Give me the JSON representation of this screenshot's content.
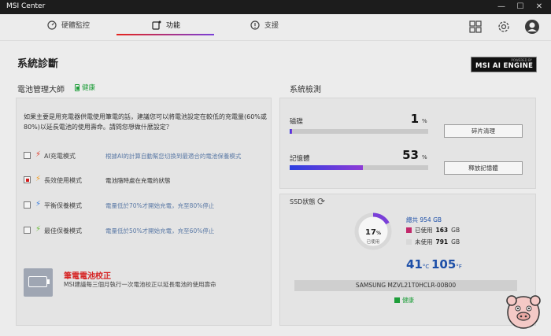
{
  "window": {
    "title": "MSI Center",
    "minimize": "—",
    "maximize": "☐",
    "close": "✕"
  },
  "nav": {
    "tabs": [
      {
        "label": "硬體監控"
      },
      {
        "label": "功能"
      },
      {
        "label": "支援"
      }
    ],
    "active_tab": "功能"
  },
  "page": {
    "title": "系統診斷",
    "badge_small": "POWERED BY",
    "badge": "MSI AI ENGINE"
  },
  "battery": {
    "heading": "電池管理大師",
    "health": "健康",
    "description": "如果主要是用充電器供電使用筆電的話，建議您可以將電池設定在較低的充電量(60%或80%)以延長電池的使用壽命。請問您想做什麼設定？",
    "modes": [
      {
        "name": "AI充電模式",
        "desc": "根據AI的計算自動幫您切換到最適合的電池保養模式",
        "bolt_color": "#e03a2a",
        "checked": false
      },
      {
        "name": "長效使用模式",
        "desc": "電池隨時處在充電的狀態",
        "bolt_color": "#f29a1f",
        "checked": true
      },
      {
        "name": "平衡保養模式",
        "desc": "電量低於70%才開始充電，充至80%停止",
        "bolt_color": "#3a7fe0",
        "checked": false
      },
      {
        "name": "最佳保養模式",
        "desc": "電量低於50%才開始充電，充至60%停止",
        "bolt_color": "#66bb33",
        "checked": false
      }
    ],
    "calibration": {
      "title": "筆電電池校正",
      "desc": "MSI建議每三個月執行一次電池校正以延長電池的使用壽命"
    }
  },
  "system_check": {
    "heading": "系統檢測",
    "disk": {
      "label": "磁碟",
      "value": "1",
      "unit": "%",
      "percent": 1,
      "button": "碎片清理"
    },
    "memory": {
      "label": "記憶體",
      "value": "53",
      "unit": "%",
      "percent": 53,
      "button": "釋放記憶體"
    }
  },
  "ssd": {
    "title": "SSD狀態",
    "used_percent": "17",
    "percent_unit": "%",
    "used_caption": "已使用",
    "total_label": "總共 954 GB",
    "used_label": "已使用",
    "used_value": "163",
    "free_label": "未使用",
    "free_value": "791",
    "gb": "GB",
    "temp_c": "41",
    "temp_c_unit": "°C",
    "temp_f": "105",
    "temp_f_unit": "°F",
    "model": "SAMSUNG MZVL21T0HCLR-00B00",
    "health": "健康",
    "colors": {
      "used": "#c2296b",
      "free": "#d8d8d8",
      "ring": "#7a3fd8"
    }
  }
}
